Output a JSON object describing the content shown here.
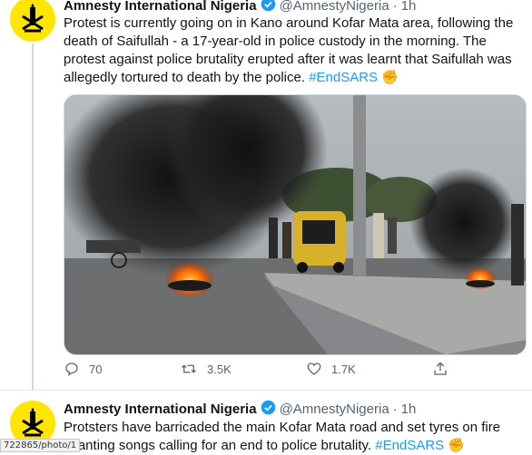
{
  "tweets": [
    {
      "author_name": "Amnesty International Nigeria",
      "handle": "@AmnestyNigeria",
      "separator": "·",
      "time": "1h",
      "text": "Protest is currently going on in Kano around Kofar Mata area, following the death of Saifullah - a 17-year-old in police custody in the morning. The protest against police brutality erupted after it was learnt that Saifullah was allegedly tortured to death by the police.",
      "hashtag": "#EndSARS",
      "emoji": "✊",
      "actions": {
        "reply_count": "70",
        "retweet_count": "3.5K",
        "like_count": "1.7K"
      }
    },
    {
      "author_name": "Amnesty International Nigeria",
      "handle": "@AmnestyNigeria",
      "separator": "·",
      "time": "1h",
      "text": "Protsters have barricaded the main Kofar Mata road and set tyres on fire chanting songs calling for an end to police brutality.",
      "hashtag": "#EndSARS",
      "emoji": "✊"
    }
  ],
  "status_url": "722865/photo/1",
  "colors": {
    "link": "#1d9bf0",
    "avatar_bg": "#ffe600",
    "verified": "#1d9bf0",
    "muted": "#536471"
  },
  "icons": [
    "verified-badge-icon",
    "reply-icon",
    "retweet-icon",
    "like-icon",
    "share-icon",
    "amnesty-candle-logo",
    "raised-fist-icon"
  ]
}
